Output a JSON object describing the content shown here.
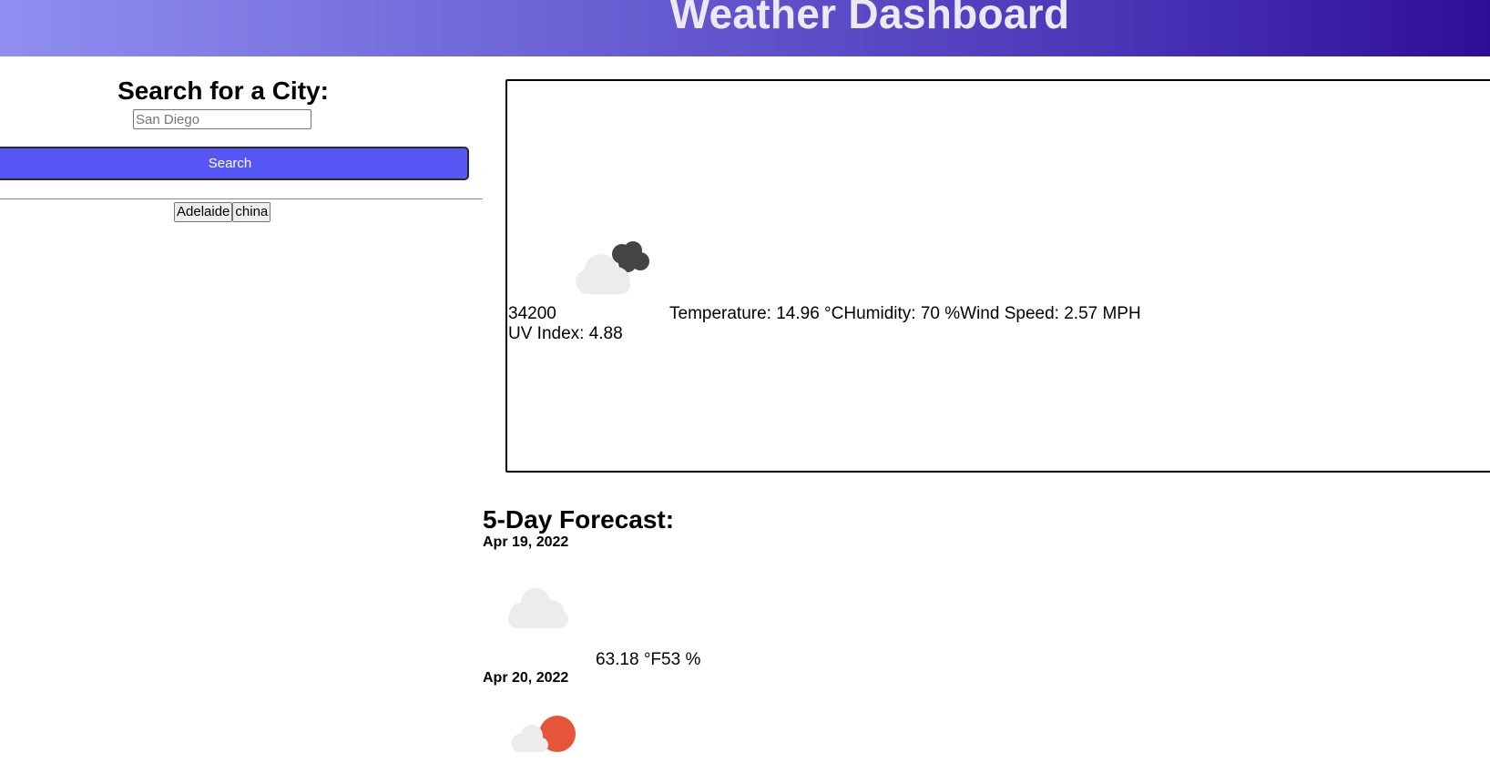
{
  "header": {
    "title": "Weather Dashboard"
  },
  "sidebar": {
    "search_title": "Search for a City:",
    "search_placeholder": "San Diego",
    "search_button_label": "Search",
    "history": [
      "Adelaide",
      "china"
    ]
  },
  "current": {
    "icon": "cloud-night-icon",
    "city": "34200",
    "temperature": "Temperature: 14.96 °C",
    "humidity": "Humidity: 70 %",
    "wind": "Wind Speed: 2.57 MPH",
    "uv": "UV Index: 4.88"
  },
  "forecast": {
    "title": "5-Day Forecast:",
    "days": [
      {
        "date": "Apr 19, 2022",
        "icon": "cloud-icon",
        "values": "63.18 °F53 %"
      },
      {
        "date": "Apr 20, 2022",
        "icon": "sun-cloud-icon"
      }
    ]
  },
  "colors": {
    "header_gradient_start": "#8f8ff0",
    "header_gradient_end": "#2e0e96",
    "search_button": "#5656f5",
    "cloud_light": "#ececec",
    "cloud_dark": "#444444",
    "sun": "#e6543a"
  }
}
